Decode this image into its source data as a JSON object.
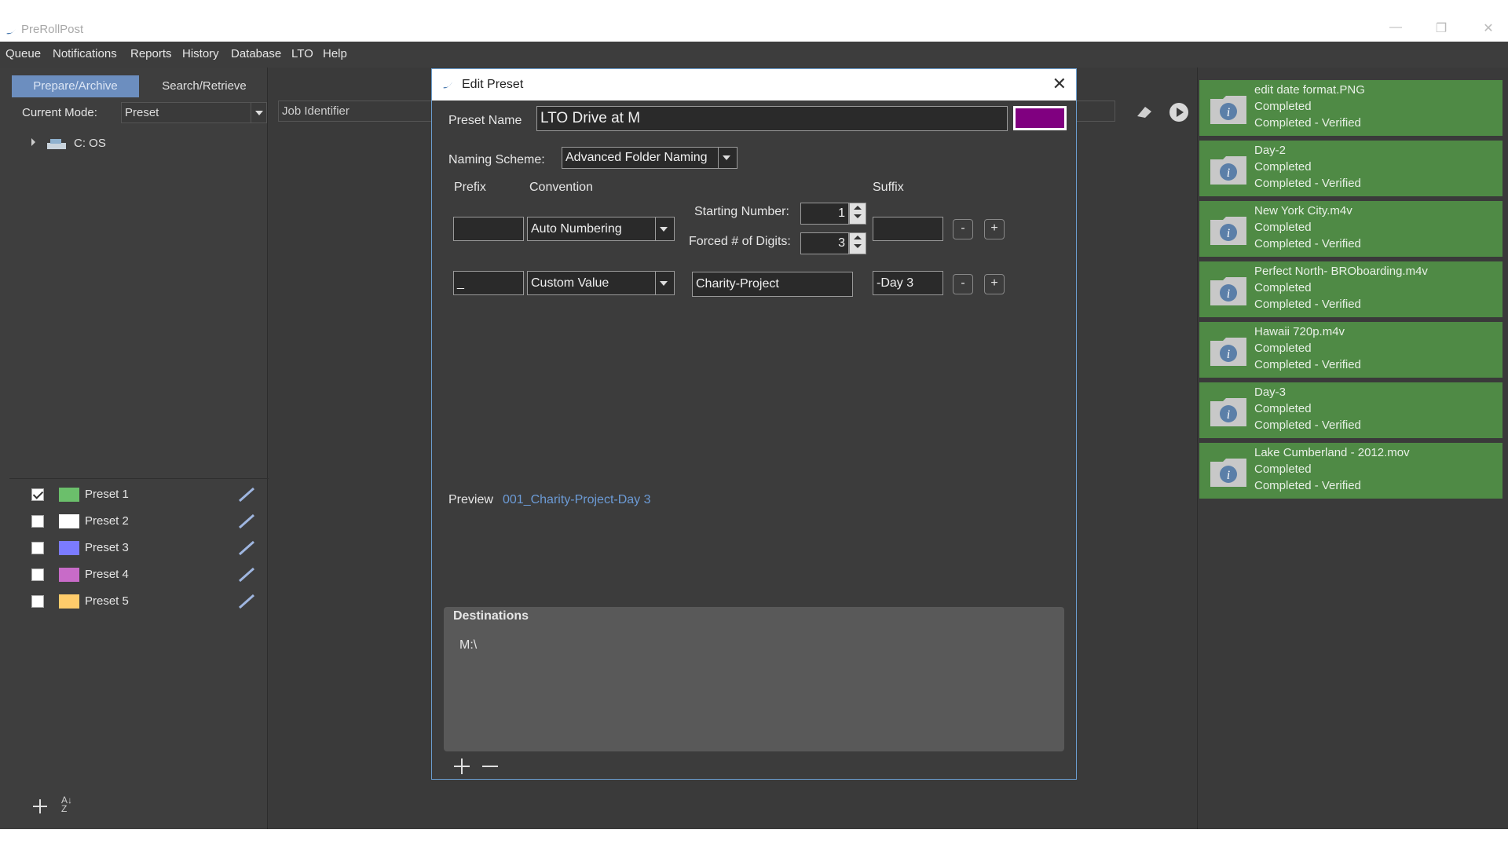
{
  "app": {
    "title": "PreRollPost"
  },
  "menu": [
    "Queue",
    "Notifications",
    "Reports",
    "History",
    "Database",
    "LTO",
    "Help"
  ],
  "tabs": {
    "prepare": "Prepare/Archive",
    "search": "Search/Retrieve"
  },
  "mode": {
    "label": "Current Mode:",
    "value": "Preset"
  },
  "job_identifier": {
    "placeholder": "Job Identifier"
  },
  "tree": {
    "root": "C: OS"
  },
  "presets": [
    {
      "name": "Preset 1",
      "color": "#6bbf6b",
      "checked": true
    },
    {
      "name": "Preset 2",
      "color": "#ffffff",
      "checked": false
    },
    {
      "name": "Preset 3",
      "color": "#7b7bff",
      "checked": false
    },
    {
      "name": "Preset 4",
      "color": "#c86bc8",
      "checked": false
    },
    {
      "name": "Preset 5",
      "color": "#ffcc6b",
      "checked": false
    }
  ],
  "jobs": [
    {
      "name": "edit date format.PNG",
      "status": "Completed",
      "verify": "Completed - Verified"
    },
    {
      "name": "Day-2",
      "status": "Completed",
      "verify": "Completed - Verified"
    },
    {
      "name": "New York City.m4v",
      "status": "Completed",
      "verify": "Completed - Verified"
    },
    {
      "name": "Perfect North- BROboarding.m4v",
      "status": "Completed",
      "verify": "Completed - Verified"
    },
    {
      "name": "Hawaii 720p.m4v",
      "status": "Completed",
      "verify": "Completed - Verified"
    },
    {
      "name": "Day-3",
      "status": "Completed",
      "verify": "Completed - Verified"
    },
    {
      "name": "Lake Cumberland - 2012.mov",
      "status": "Completed",
      "verify": "Completed - Verified"
    }
  ],
  "dialog": {
    "title": "Edit Preset",
    "preset_name_label": "Preset Name",
    "preset_name_value": "LTO Drive at M",
    "preset_color": "#800080",
    "naming_scheme_label": "Naming Scheme:",
    "naming_scheme_value": "Advanced Folder Naming",
    "col_prefix": "Prefix",
    "col_convention": "Convention",
    "col_suffix": "Suffix",
    "row1": {
      "prefix": "",
      "convention": "Auto Numbering",
      "starting_number_label": "Starting Number:",
      "starting_number": "1",
      "forced_digits_label": "Forced # of Digits:",
      "forced_digits": "3",
      "suffix": ""
    },
    "row2": {
      "prefix": "_",
      "convention": "Custom Value",
      "value": "Charity-Project",
      "suffix": "-Day 3"
    },
    "minus": "-",
    "plus": "+",
    "preview_label": "Preview",
    "preview_value": "001_Charity-Project-Day 3",
    "destinations_label": "Destinations",
    "destinations": [
      "M:\\"
    ]
  },
  "colors": {
    "job_card": "#4f8a45",
    "accent": "#6c8ebf",
    "preview": "#6c9bd6"
  }
}
